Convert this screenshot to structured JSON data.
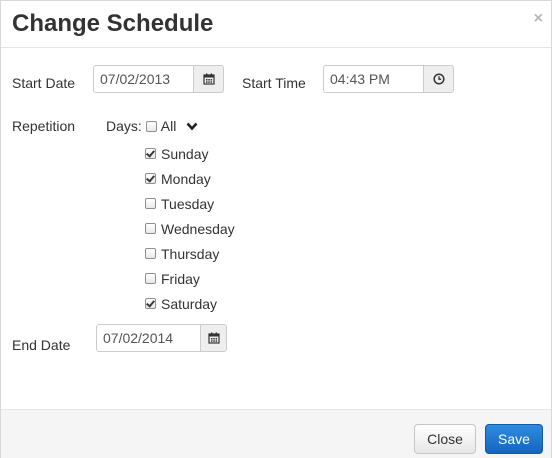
{
  "dialog": {
    "title": "Change Schedule",
    "close_glyph": "×"
  },
  "start_date": {
    "label": "Start Date",
    "value": "07/02/2013",
    "icon": "calendar-icon"
  },
  "start_time": {
    "label": "Start Time",
    "value": "04:43 PM",
    "icon": "clock-icon"
  },
  "repetition": {
    "label": "Repetition",
    "days_label": "Days:",
    "all_label": "All",
    "all_checked": false,
    "dropdown_icon": "chevron-down-icon",
    "days": [
      {
        "label": "Sunday",
        "checked": true
      },
      {
        "label": "Monday",
        "checked": true
      },
      {
        "label": "Tuesday",
        "checked": false
      },
      {
        "label": "Wednesday",
        "checked": false
      },
      {
        "label": "Thursday",
        "checked": false
      },
      {
        "label": "Friday",
        "checked": false
      },
      {
        "label": "Saturday",
        "checked": true
      }
    ]
  },
  "end_date": {
    "label": "End Date",
    "value": "07/02/2014",
    "icon": "calendar-icon"
  },
  "footer": {
    "close_label": "Close",
    "save_label": "Save"
  },
  "colors": {
    "primary": "#1a73d1",
    "footer_bg": "#f5f5f5"
  }
}
